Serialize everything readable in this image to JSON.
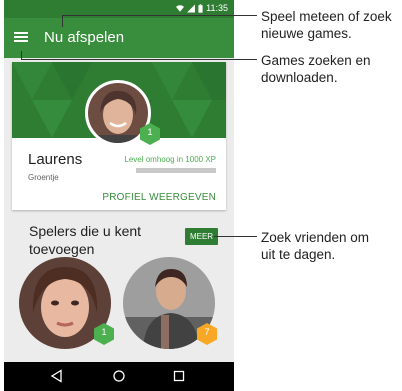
{
  "status_bar": {
    "time": "11:35"
  },
  "app_bar": {
    "title": "Nu afspelen",
    "menu_icon": "hamburger-icon"
  },
  "profile": {
    "name": "Laurens",
    "rank": "Groentje",
    "badge_level": "1",
    "level_up_text": "Level omhoog in 1000 XP",
    "xp_progress": 0.0,
    "link": "PROFIEL WEERGEVEN"
  },
  "suggestions": {
    "title": "Spelers die u kent toevoegen",
    "more_button": "MEER",
    "players": [
      {
        "badge_level": "1",
        "badge_color": "#4caf50"
      },
      {
        "badge_level": "7",
        "badge_color": "#f9a825"
      }
    ]
  },
  "nav_bar": {
    "icons": [
      "back-icon",
      "home-icon",
      "recents-icon"
    ]
  },
  "callouts": {
    "menu": "Speel meteen of zoek\nnieuwe games.",
    "title": "Games zoeken en\ndownloaden.",
    "more": "Zoek vrienden om\nuit te dagen."
  },
  "colors": {
    "primary": "#388e3c",
    "primary_dark": "#2e7d32",
    "accent": "#4caf50"
  }
}
